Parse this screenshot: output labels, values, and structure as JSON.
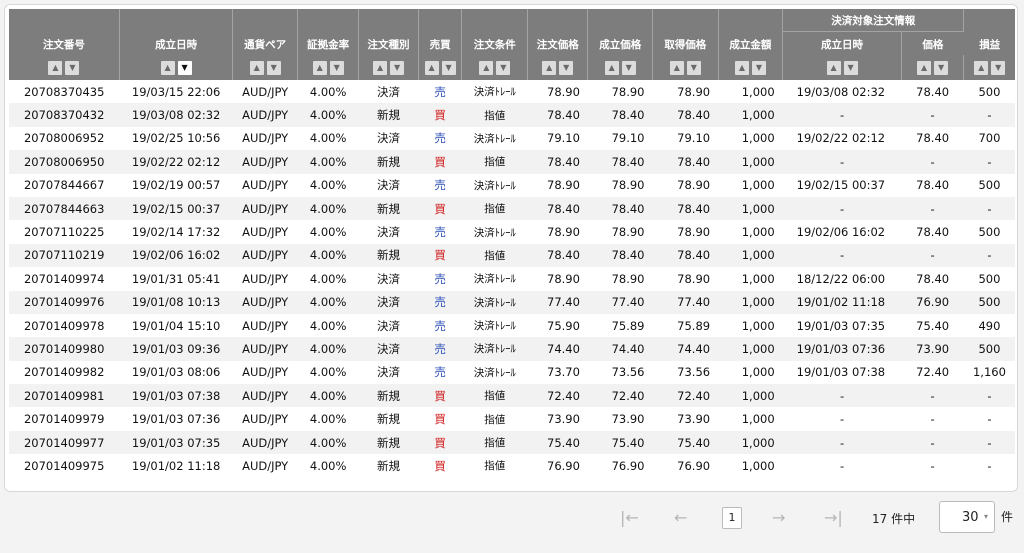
{
  "headers": {
    "order_no": "注文番号",
    "exec_time": "成立日時",
    "pair": "通貨ペア",
    "margin": "証拠金率",
    "order_type": "注文種別",
    "side": "売買",
    "condition": "注文条件",
    "order_price": "注文価格",
    "exec_price": "成立価格",
    "acq_price": "取得価格",
    "amount": "成立金額",
    "group": "決済対象注文情報",
    "settle_time": "成立日時",
    "settle_price": "価格",
    "pnl": "損益"
  },
  "sort_icons": {
    "up": "▲",
    "down": "▼"
  },
  "rows": [
    [
      "20708370435",
      "19/03/15 22:06",
      "AUD/JPY",
      "4.00%",
      "決済",
      "売",
      "決済ﾄﾚｰﾙ",
      "78.90",
      "78.90",
      "78.90",
      "1,000",
      "19/03/08 02:32",
      "78.40",
      "500"
    ],
    [
      "20708370432",
      "19/03/08 02:32",
      "AUD/JPY",
      "4.00%",
      "新規",
      "買",
      "指値",
      "78.40",
      "78.40",
      "78.40",
      "1,000",
      "-",
      "-",
      "-"
    ],
    [
      "20708006952",
      "19/02/25 10:56",
      "AUD/JPY",
      "4.00%",
      "決済",
      "売",
      "決済ﾄﾚｰﾙ",
      "79.10",
      "79.10",
      "79.10",
      "1,000",
      "19/02/22 02:12",
      "78.40",
      "700"
    ],
    [
      "20708006950",
      "19/02/22 02:12",
      "AUD/JPY",
      "4.00%",
      "新規",
      "買",
      "指値",
      "78.40",
      "78.40",
      "78.40",
      "1,000",
      "-",
      "-",
      "-"
    ],
    [
      "20707844667",
      "19/02/19 00:57",
      "AUD/JPY",
      "4.00%",
      "決済",
      "売",
      "決済ﾄﾚｰﾙ",
      "78.90",
      "78.90",
      "78.90",
      "1,000",
      "19/02/15 00:37",
      "78.40",
      "500"
    ],
    [
      "20707844663",
      "19/02/15 00:37",
      "AUD/JPY",
      "4.00%",
      "新規",
      "買",
      "指値",
      "78.40",
      "78.40",
      "78.40",
      "1,000",
      "-",
      "-",
      "-"
    ],
    [
      "20707110225",
      "19/02/14 17:32",
      "AUD/JPY",
      "4.00%",
      "決済",
      "売",
      "決済ﾄﾚｰﾙ",
      "78.90",
      "78.90",
      "78.90",
      "1,000",
      "19/02/06 16:02",
      "78.40",
      "500"
    ],
    [
      "20707110219",
      "19/02/06 16:02",
      "AUD/JPY",
      "4.00%",
      "新規",
      "買",
      "指値",
      "78.40",
      "78.40",
      "78.40",
      "1,000",
      "-",
      "-",
      "-"
    ],
    [
      "20701409974",
      "19/01/31 05:41",
      "AUD/JPY",
      "4.00%",
      "決済",
      "売",
      "決済ﾄﾚｰﾙ",
      "78.90",
      "78.90",
      "78.90",
      "1,000",
      "18/12/22 06:00",
      "78.40",
      "500"
    ],
    [
      "20701409976",
      "19/01/08 10:13",
      "AUD/JPY",
      "4.00%",
      "決済",
      "売",
      "決済ﾄﾚｰﾙ",
      "77.40",
      "77.40",
      "77.40",
      "1,000",
      "19/01/02 11:18",
      "76.90",
      "500"
    ],
    [
      "20701409978",
      "19/01/04 15:10",
      "AUD/JPY",
      "4.00%",
      "決済",
      "売",
      "決済ﾄﾚｰﾙ",
      "75.90",
      "75.89",
      "75.89",
      "1,000",
      "19/01/03 07:35",
      "75.40",
      "490"
    ],
    [
      "20701409980",
      "19/01/03 09:36",
      "AUD/JPY",
      "4.00%",
      "決済",
      "売",
      "決済ﾄﾚｰﾙ",
      "74.40",
      "74.40",
      "74.40",
      "1,000",
      "19/01/03 07:36",
      "73.90",
      "500"
    ],
    [
      "20701409982",
      "19/01/03 08:06",
      "AUD/JPY",
      "4.00%",
      "決済",
      "売",
      "決済ﾄﾚｰﾙ",
      "73.70",
      "73.56",
      "73.56",
      "1,000",
      "19/01/03 07:38",
      "72.40",
      "1,160"
    ],
    [
      "20701409981",
      "19/01/03 07:38",
      "AUD/JPY",
      "4.00%",
      "新規",
      "買",
      "指値",
      "72.40",
      "72.40",
      "72.40",
      "1,000",
      "-",
      "-",
      "-"
    ],
    [
      "20701409979",
      "19/01/03 07:36",
      "AUD/JPY",
      "4.00%",
      "新規",
      "買",
      "指値",
      "73.90",
      "73.90",
      "73.90",
      "1,000",
      "-",
      "-",
      "-"
    ],
    [
      "20701409977",
      "19/01/03 07:35",
      "AUD/JPY",
      "4.00%",
      "新規",
      "買",
      "指値",
      "75.40",
      "75.40",
      "75.40",
      "1,000",
      "-",
      "-",
      "-"
    ],
    [
      "20701409975",
      "19/01/02 11:18",
      "AUD/JPY",
      "4.00%",
      "新規",
      "買",
      "指値",
      "76.90",
      "76.90",
      "76.90",
      "1,000",
      "-",
      "-",
      "-"
    ]
  ],
  "pager": {
    "first": "|←",
    "prev": "←",
    "page": "1",
    "next": "→",
    "last": "→|",
    "total": "17 件中",
    "per_page": "30",
    "per_page_arrow": "▾",
    "unit": "件"
  },
  "colors": {
    "header_bg": "#7d7d7d",
    "sell": "#2a4db8",
    "buy": "#d01c1c"
  }
}
